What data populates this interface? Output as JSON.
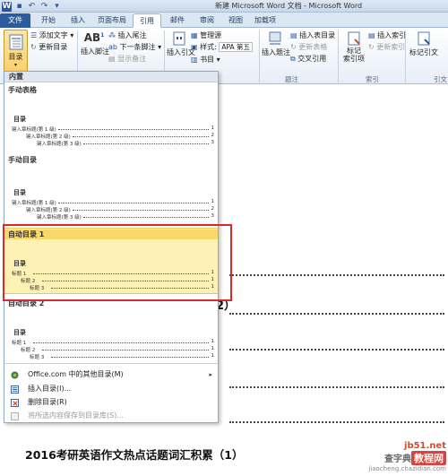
{
  "window": {
    "title": "新建 Microsoft Word 文档 - Microsoft Word",
    "qat_icons": [
      "word-logo-icon",
      "save-icon",
      "undo-icon",
      "redo-icon",
      "customize-icon"
    ]
  },
  "tabs": [
    "文件",
    "开始",
    "插入",
    "页面布局",
    "引用",
    "邮件",
    "审阅",
    "视图",
    "加载项"
  ],
  "ribbon": {
    "toc_button": "目录",
    "add_text": "添加文字",
    "update_toc": "更新目录",
    "insert_footnote": "插入脚注",
    "insert_endnote": "插入尾注",
    "next_footnote": "下一条脚注",
    "show_notes": "显示备注",
    "insert_citation": "插入引文",
    "manage_sources": "管理源",
    "style_label": "样式:",
    "style_value": "APA 第五",
    "bibliography": "书目",
    "insert_caption": "插入题注",
    "insert_table_of_figures": "插入表目录",
    "update_table": "更新表格",
    "cross_reference": "交叉引用",
    "caption_group": "题注",
    "mark_entry": "标记\n索引项",
    "insert_index": "插入索引",
    "update_index": "更新索引",
    "index_group": "索引",
    "mark_citation": "标记引文",
    "toa_group": "引文目录"
  },
  "gallery": {
    "header": "内置",
    "entries": [
      {
        "title": "手动表格",
        "heading": "目录",
        "lines": [
          {
            "text": "键入章标题(第 1 级)",
            "page": "1",
            "level": 1
          },
          {
            "text": "键入章标题(第 2 级)",
            "page": "2",
            "level": 2
          },
          {
            "text": "键入章标题(第 3 级)",
            "page": "3",
            "level": 3
          }
        ]
      },
      {
        "title": "手动目录",
        "heading": "目录",
        "lines": [
          {
            "text": "键入章标题(第 1 级)",
            "page": "1",
            "level": 1
          },
          {
            "text": "键入章标题(第 2 级)",
            "page": "2",
            "level": 2
          },
          {
            "text": "键入章标题(第 3 级)",
            "page": "3",
            "level": 3
          }
        ]
      },
      {
        "title": "自动目录 1",
        "heading": "目录",
        "lines": [
          {
            "text": "标题 1",
            "page": "1",
            "level": 1
          },
          {
            "text": "标题 2",
            "page": "1",
            "level": 2
          },
          {
            "text": "标题 3",
            "page": "1",
            "level": 3
          }
        ]
      },
      {
        "title": "自动目录 2",
        "heading": "目录",
        "lines": [
          {
            "text": "标题 1",
            "page": "1",
            "level": 1
          },
          {
            "text": "标题 2",
            "page": "1",
            "level": 2
          },
          {
            "text": "标题 3",
            "page": "1",
            "level": 3
          }
        ]
      }
    ],
    "menu": [
      {
        "label": "Office.com 中的其他目录(M)",
        "has_submenu": true,
        "enabled": true,
        "icon": "office-online-icon"
      },
      {
        "label": "插入目录(I)...",
        "has_submenu": false,
        "enabled": true,
        "icon": "insert-toc-icon"
      },
      {
        "label": "删除目录(R)",
        "has_submenu": false,
        "enabled": true,
        "icon": "delete-toc-icon"
      },
      {
        "label": "将所选内容保存到目录库(S)...",
        "has_submenu": false,
        "enabled": false,
        "icon": "save-selection-icon"
      }
    ]
  },
  "document": {
    "fragment_paren": "2）",
    "bottom_line": "2016考研英语作文热点话题词汇积累（1）"
  },
  "watermark": {
    "site": "jb51.net",
    "prefix": "查字典",
    "box": "教程网",
    "url": "jiaocheng.chazidian.com"
  },
  "colors": {
    "file_tab": "#2a5b9f",
    "highlight": "#fdf1b3",
    "callout": "#d82a2a"
  }
}
